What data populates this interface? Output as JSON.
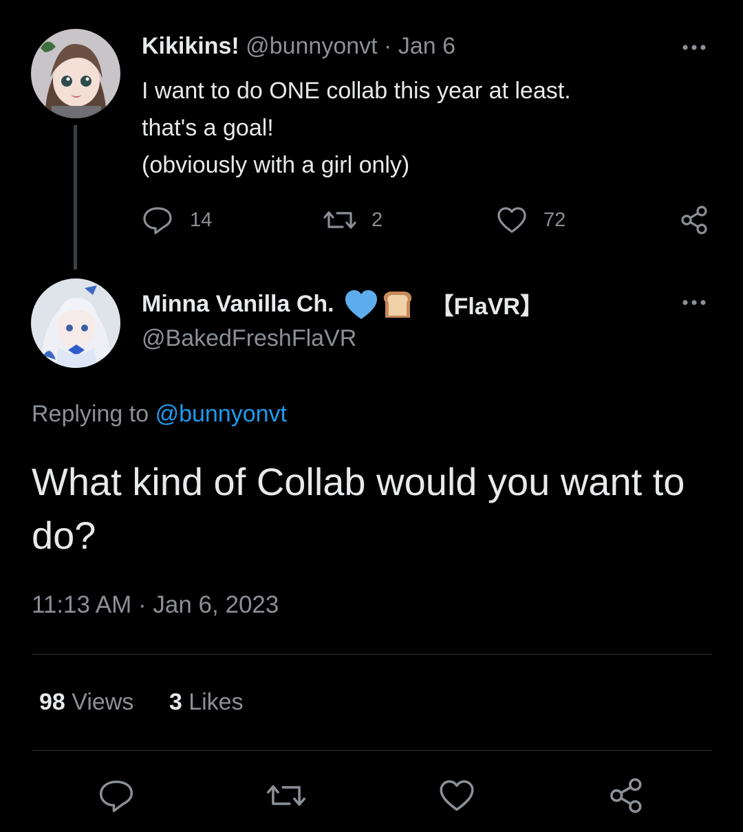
{
  "parent_tweet": {
    "display_name": "Kikikins!",
    "handle": "@bunnyonvt",
    "separator": "·",
    "date": "Jan 6",
    "text_lines": [
      "I want to do ONE collab this year at least.",
      "that's a goal!",
      "(obviously with a girl only)"
    ],
    "actions": {
      "replies": "14",
      "retweets": "2",
      "likes": "72"
    }
  },
  "reply_tweet": {
    "display_name": "Minna Vanilla Ch.",
    "name_suffix": "【FlaVR】",
    "handle": "@BakedFreshFlaVR",
    "replying_to_label": "Replying to",
    "replying_to_handle": "@bunnyonvt",
    "text": "What kind of Collab would you want to do?",
    "time": "11:13 AM",
    "separator": "·",
    "date": "Jan 6, 2023",
    "stats": {
      "views_count": "98",
      "views_label": "Views",
      "likes_count": "3",
      "likes_label": "Likes"
    }
  },
  "icons": {
    "reply": "reply-icon",
    "retweet": "retweet-icon",
    "like": "heart-icon",
    "share": "share-icon",
    "more": "more-icon",
    "badge_heart": "blue-heart-emoji",
    "badge_bread": "bread-emoji"
  },
  "colors": {
    "background": "#000000",
    "text": "#e7e9ea",
    "muted": "#8b9095",
    "link": "#1d9bf0",
    "divider": "#2f3336"
  }
}
